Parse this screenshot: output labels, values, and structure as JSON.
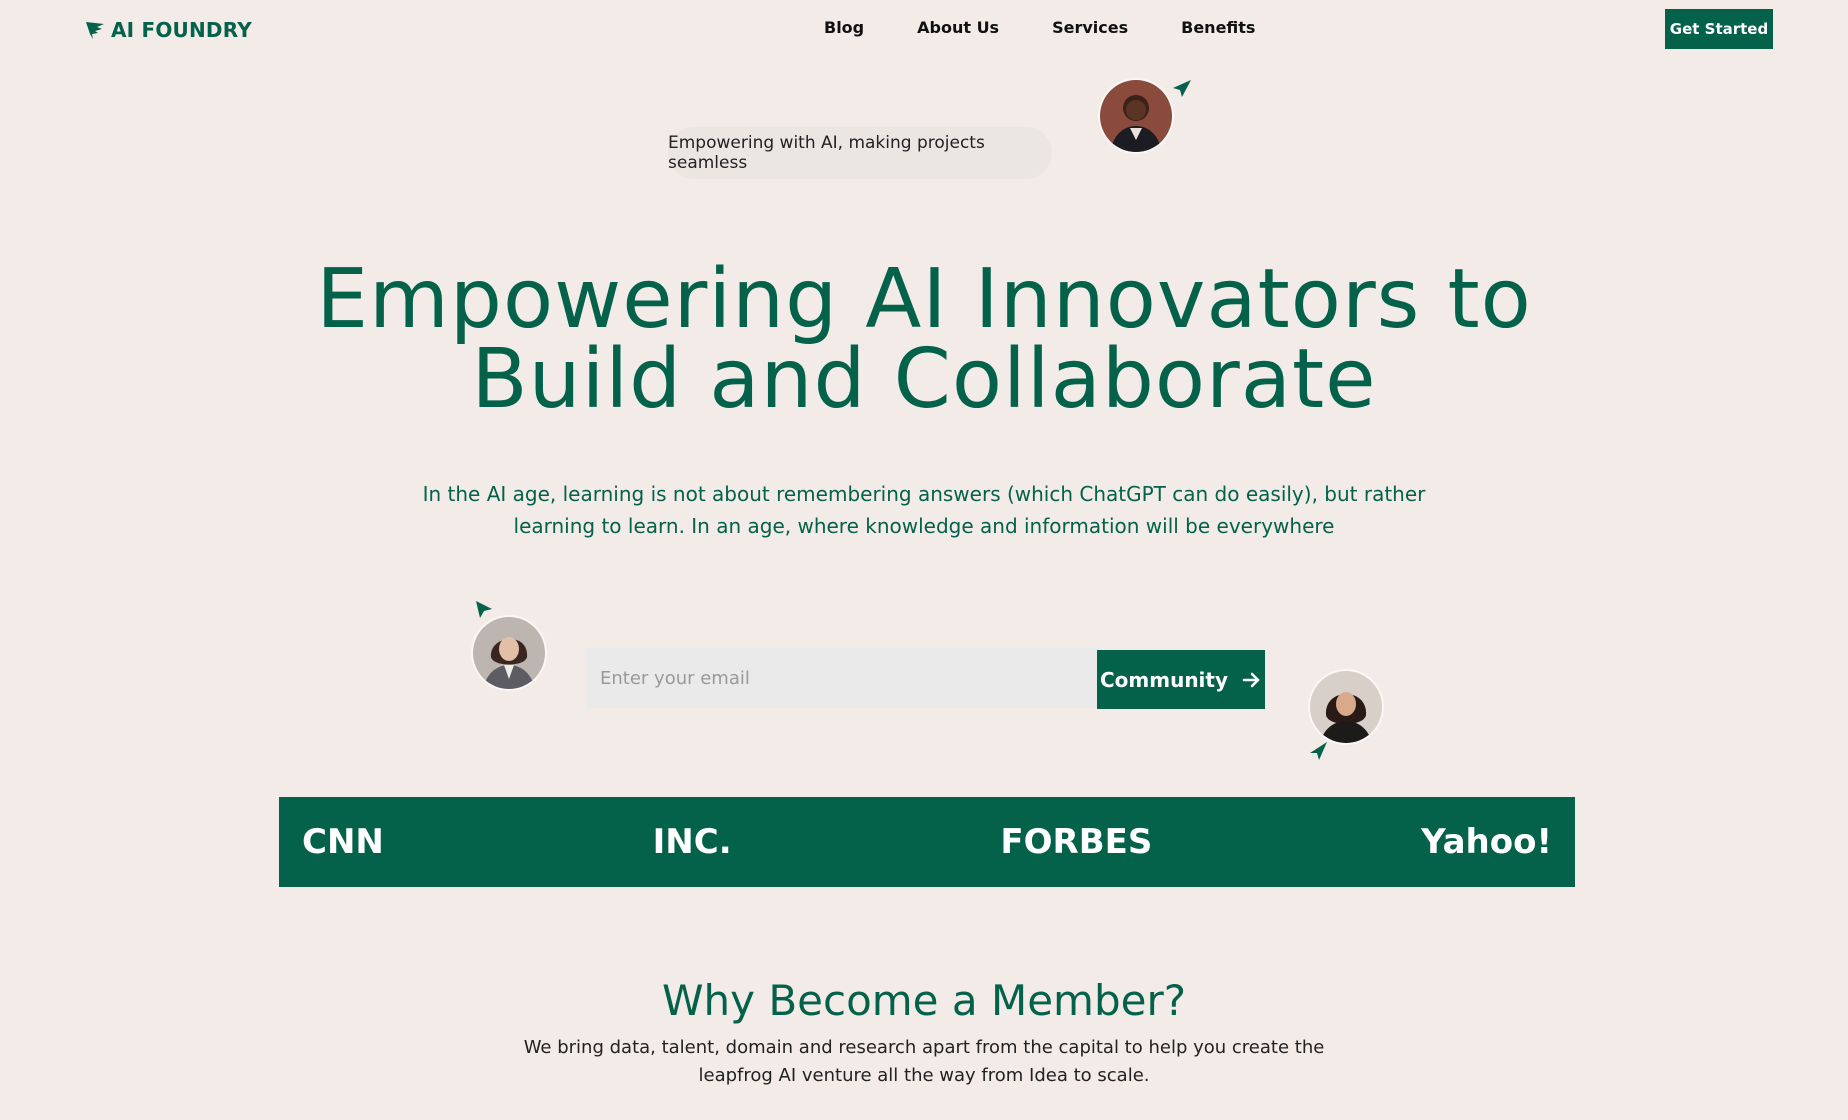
{
  "header": {
    "logo_text": "AI FOUNDRY",
    "nav": [
      {
        "label": "Blog"
      },
      {
        "label": "About Us"
      },
      {
        "label": "Services"
      },
      {
        "label": "Benefits"
      }
    ],
    "cta_label": "Get Started"
  },
  "hero": {
    "pill_text": "Empowering with AI, making projects seamless",
    "title_line1": "Empowering AI Innovators to",
    "title_line2": "Build and Collaborate",
    "subtitle": "In the AI age, learning is not about remembering answers (which ChatGPT can do easily), but rather learning to learn. In an age, where knowledge and information will be everywhere"
  },
  "signup": {
    "placeholder": "Enter your email",
    "button_label": "Community"
  },
  "press": [
    "CNN",
    "INC.",
    "FORBES",
    "Yahoo!"
  ],
  "why": {
    "title": "Why Become a Member?",
    "subtitle": "We bring data, talent, domain and research apart from the capital to help you create the leapfrog AI venture all the way from Idea to scale."
  },
  "colors": {
    "brand": "#04614a",
    "background": "#f2ebe8"
  },
  "icons": [
    "logo-leaf-icon",
    "cursor-icon",
    "arrow-right-icon"
  ]
}
